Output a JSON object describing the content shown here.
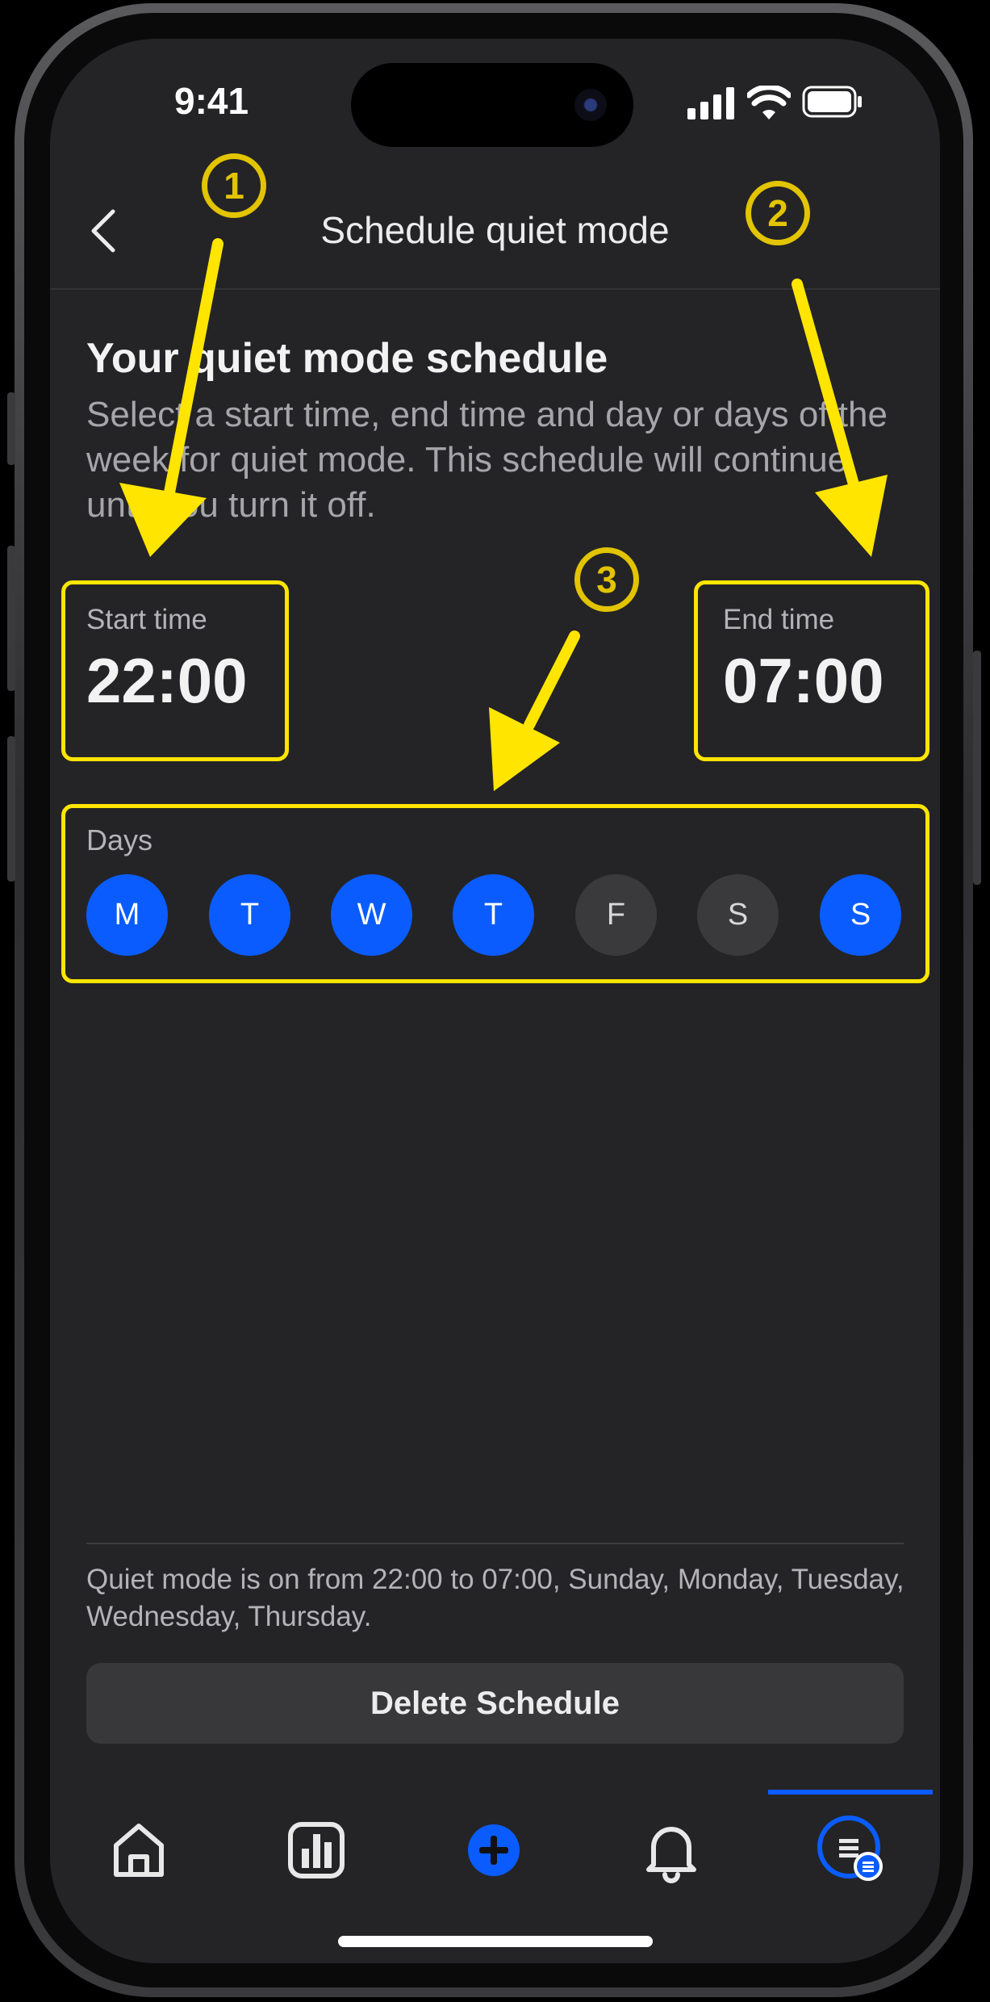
{
  "status_bar": {
    "time": "9:41"
  },
  "header": {
    "title": "Schedule quiet mode"
  },
  "intro": {
    "title": "Your quiet mode schedule",
    "description": "Select a start time, end time and day or days of the week for quiet mode. This schedule will continue until you turn it off."
  },
  "start_time": {
    "label": "Start time",
    "value": "22:00"
  },
  "end_time": {
    "label": "End time",
    "value": "07:00"
  },
  "days": {
    "label": "Days",
    "items": [
      {
        "letter": "M",
        "selected": true
      },
      {
        "letter": "T",
        "selected": true
      },
      {
        "letter": "W",
        "selected": true
      },
      {
        "letter": "T",
        "selected": true
      },
      {
        "letter": "F",
        "selected": false
      },
      {
        "letter": "S",
        "selected": false
      },
      {
        "letter": "S",
        "selected": true
      }
    ]
  },
  "summary": "Quiet mode is on from 22:00 to 07:00, Sunday, Monday, Tuesday, Wednesday, Thursday.",
  "delete_button": "Delete Schedule",
  "annotations": {
    "one": "1",
    "two": "2",
    "three": "3"
  },
  "tab_bar": {
    "items": [
      "home-icon",
      "stats-icon",
      "create-icon",
      "notifications-icon",
      "menu-icon"
    ],
    "active": "menu-icon"
  },
  "colors": {
    "accent": "#0a5cff",
    "background": "#242426",
    "highlight": "#ffe500",
    "annotation": "#e2c400"
  }
}
